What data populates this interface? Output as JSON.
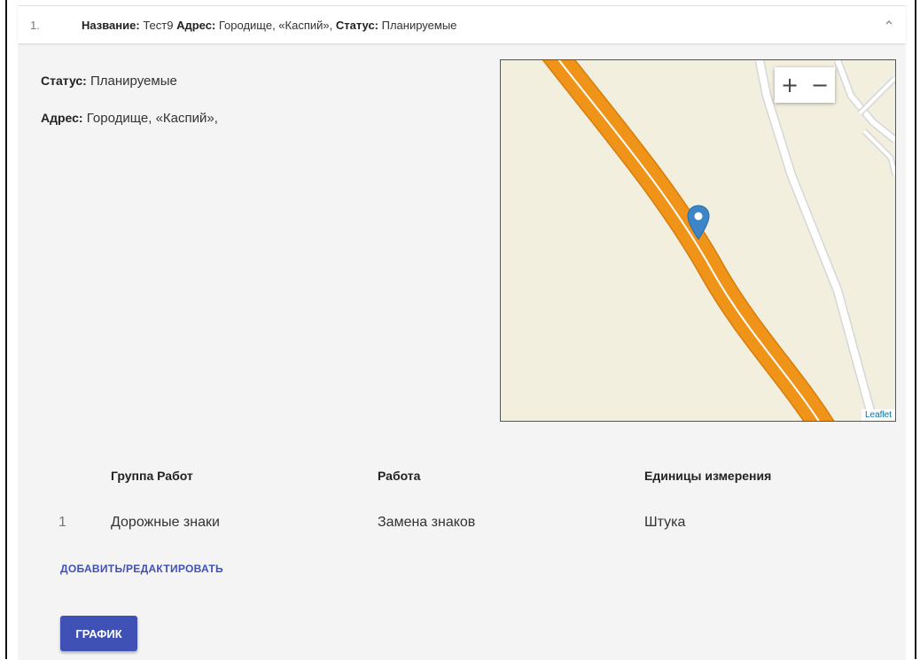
{
  "item": {
    "index": "1.",
    "summary": {
      "name_label": "Название:",
      "name_value": " Тест9 ",
      "address_label": "Адрес:",
      "address_value": " Городище, «Каспий», ",
      "status_label": "Статус:",
      "status_value": " Планируемые"
    },
    "collapse_icon": "chevron-up-icon"
  },
  "details": {
    "status_label": "Статус:",
    "status_value": " Планируемые",
    "address_label": "Адрес:",
    "address_value": " Городище, «Каспий»,"
  },
  "map": {
    "zoom_in": "+",
    "zoom_out": "−",
    "attribution": "Leaflet",
    "marker_icon": "map-marker-icon",
    "colors": {
      "land": "#f2efdf",
      "highway": "#ef9418",
      "road_white": "#ffffff",
      "marker": "#3d85c6"
    }
  },
  "works_table": {
    "headers": [
      "Группа Работ",
      "Работа",
      "Единицы измерения"
    ],
    "rows": [
      {
        "num": "1",
        "group": "Дорожные знаки",
        "work": "Замена знаков",
        "unit": "Штука"
      }
    ]
  },
  "actions": {
    "add_edit": "ДОБАВИТЬ/РЕДАКТИРОВАТЬ",
    "schedule": "ГРАФИК"
  },
  "colors": {
    "accent": "#3f51b5",
    "panel_bg": "#f4f4f4"
  }
}
